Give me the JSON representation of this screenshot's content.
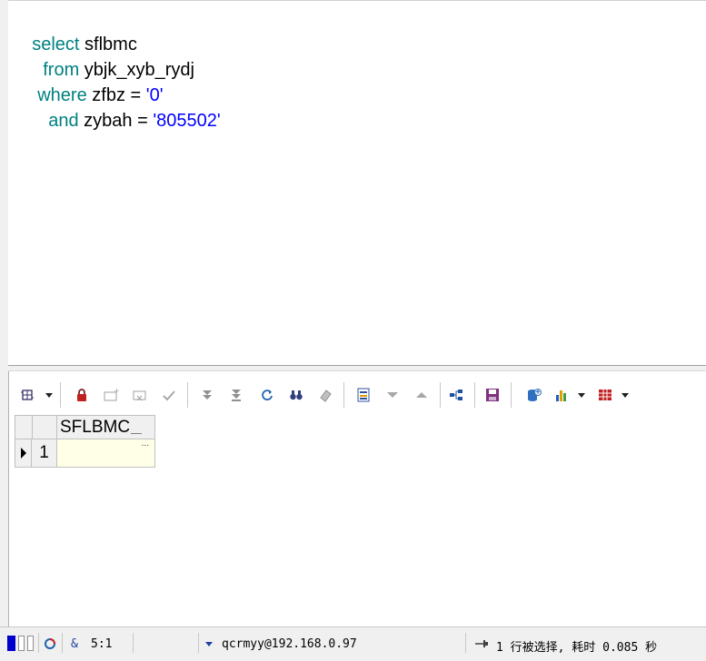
{
  "editor": {
    "lines": [
      {
        "kw": "select",
        "rest": " sflbmc"
      },
      {
        "kw": "from",
        "rest": " ybjk_xyb_rydj"
      },
      {
        "kw": "where",
        "rest": " zfbz = ",
        "str": "'0'"
      },
      {
        "kw": "and",
        "rest": " zybah = ",
        "str": "'805502'"
      }
    ]
  },
  "grid": {
    "columns": [
      "SFLBMC"
    ],
    "rows": [
      {
        "num": "1",
        "SFLBMC": ""
      }
    ],
    "cell_ellipsis": "..."
  },
  "statusbar": {
    "cursor_position": "5:1",
    "connection": "qcrmyy@192.168.0.97",
    "message": "1 行被选择, 耗时 0.085 秒"
  },
  "icons": {
    "toolbar": [
      "grid-options-icon",
      "lock-icon",
      "insert-record-icon",
      "delete-record-icon",
      "post-changes-icon",
      "fetch-next-page-icon",
      "fetch-last-page-icon",
      "refresh-icon",
      "find-icon",
      "clear-icon",
      "single-record-view-icon",
      "next-record-icon",
      "previous-record-icon",
      "query-by-example-icon",
      "save-icon",
      "export-icon",
      "chart-icon",
      "table-view-icon"
    ]
  },
  "colors": {
    "keyword": "#008080",
    "string": "#0000ff",
    "cell_bg": "#ffffe8"
  }
}
